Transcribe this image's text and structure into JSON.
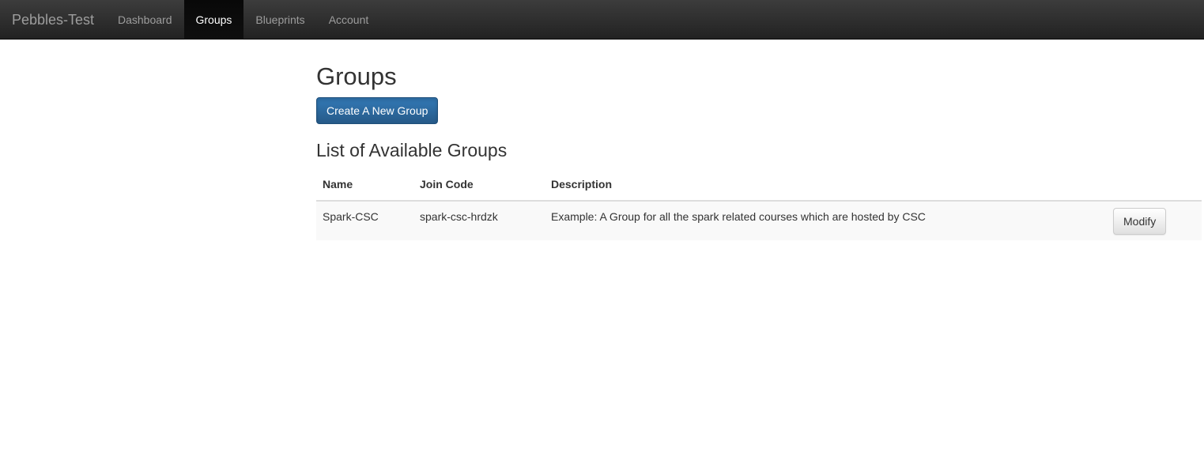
{
  "navbar": {
    "brand": "Pebbles-Test",
    "items": [
      {
        "label": "Dashboard",
        "active": false
      },
      {
        "label": "Groups",
        "active": true
      },
      {
        "label": "Blueprints",
        "active": false
      },
      {
        "label": "Account",
        "active": false
      }
    ]
  },
  "main": {
    "title": "Groups",
    "create_button_label": "Create A New Group",
    "list_title": "List of Available Groups",
    "table": {
      "columns": [
        "Name",
        "Join Code",
        "Description",
        ""
      ],
      "rows": [
        {
          "name": "Spark-CSC",
          "join_code": "spark-csc-hrdzk",
          "description": "Example: A Group for all the spark related courses which are hosted by CSC",
          "action_label": "Modify"
        }
      ]
    }
  },
  "colors": {
    "navbar_bg": "#222222",
    "nav_text": "#9d9d9d",
    "nav_active_text": "#ffffff",
    "primary": "#337ab7",
    "striped_row": "#f9f9f9"
  }
}
